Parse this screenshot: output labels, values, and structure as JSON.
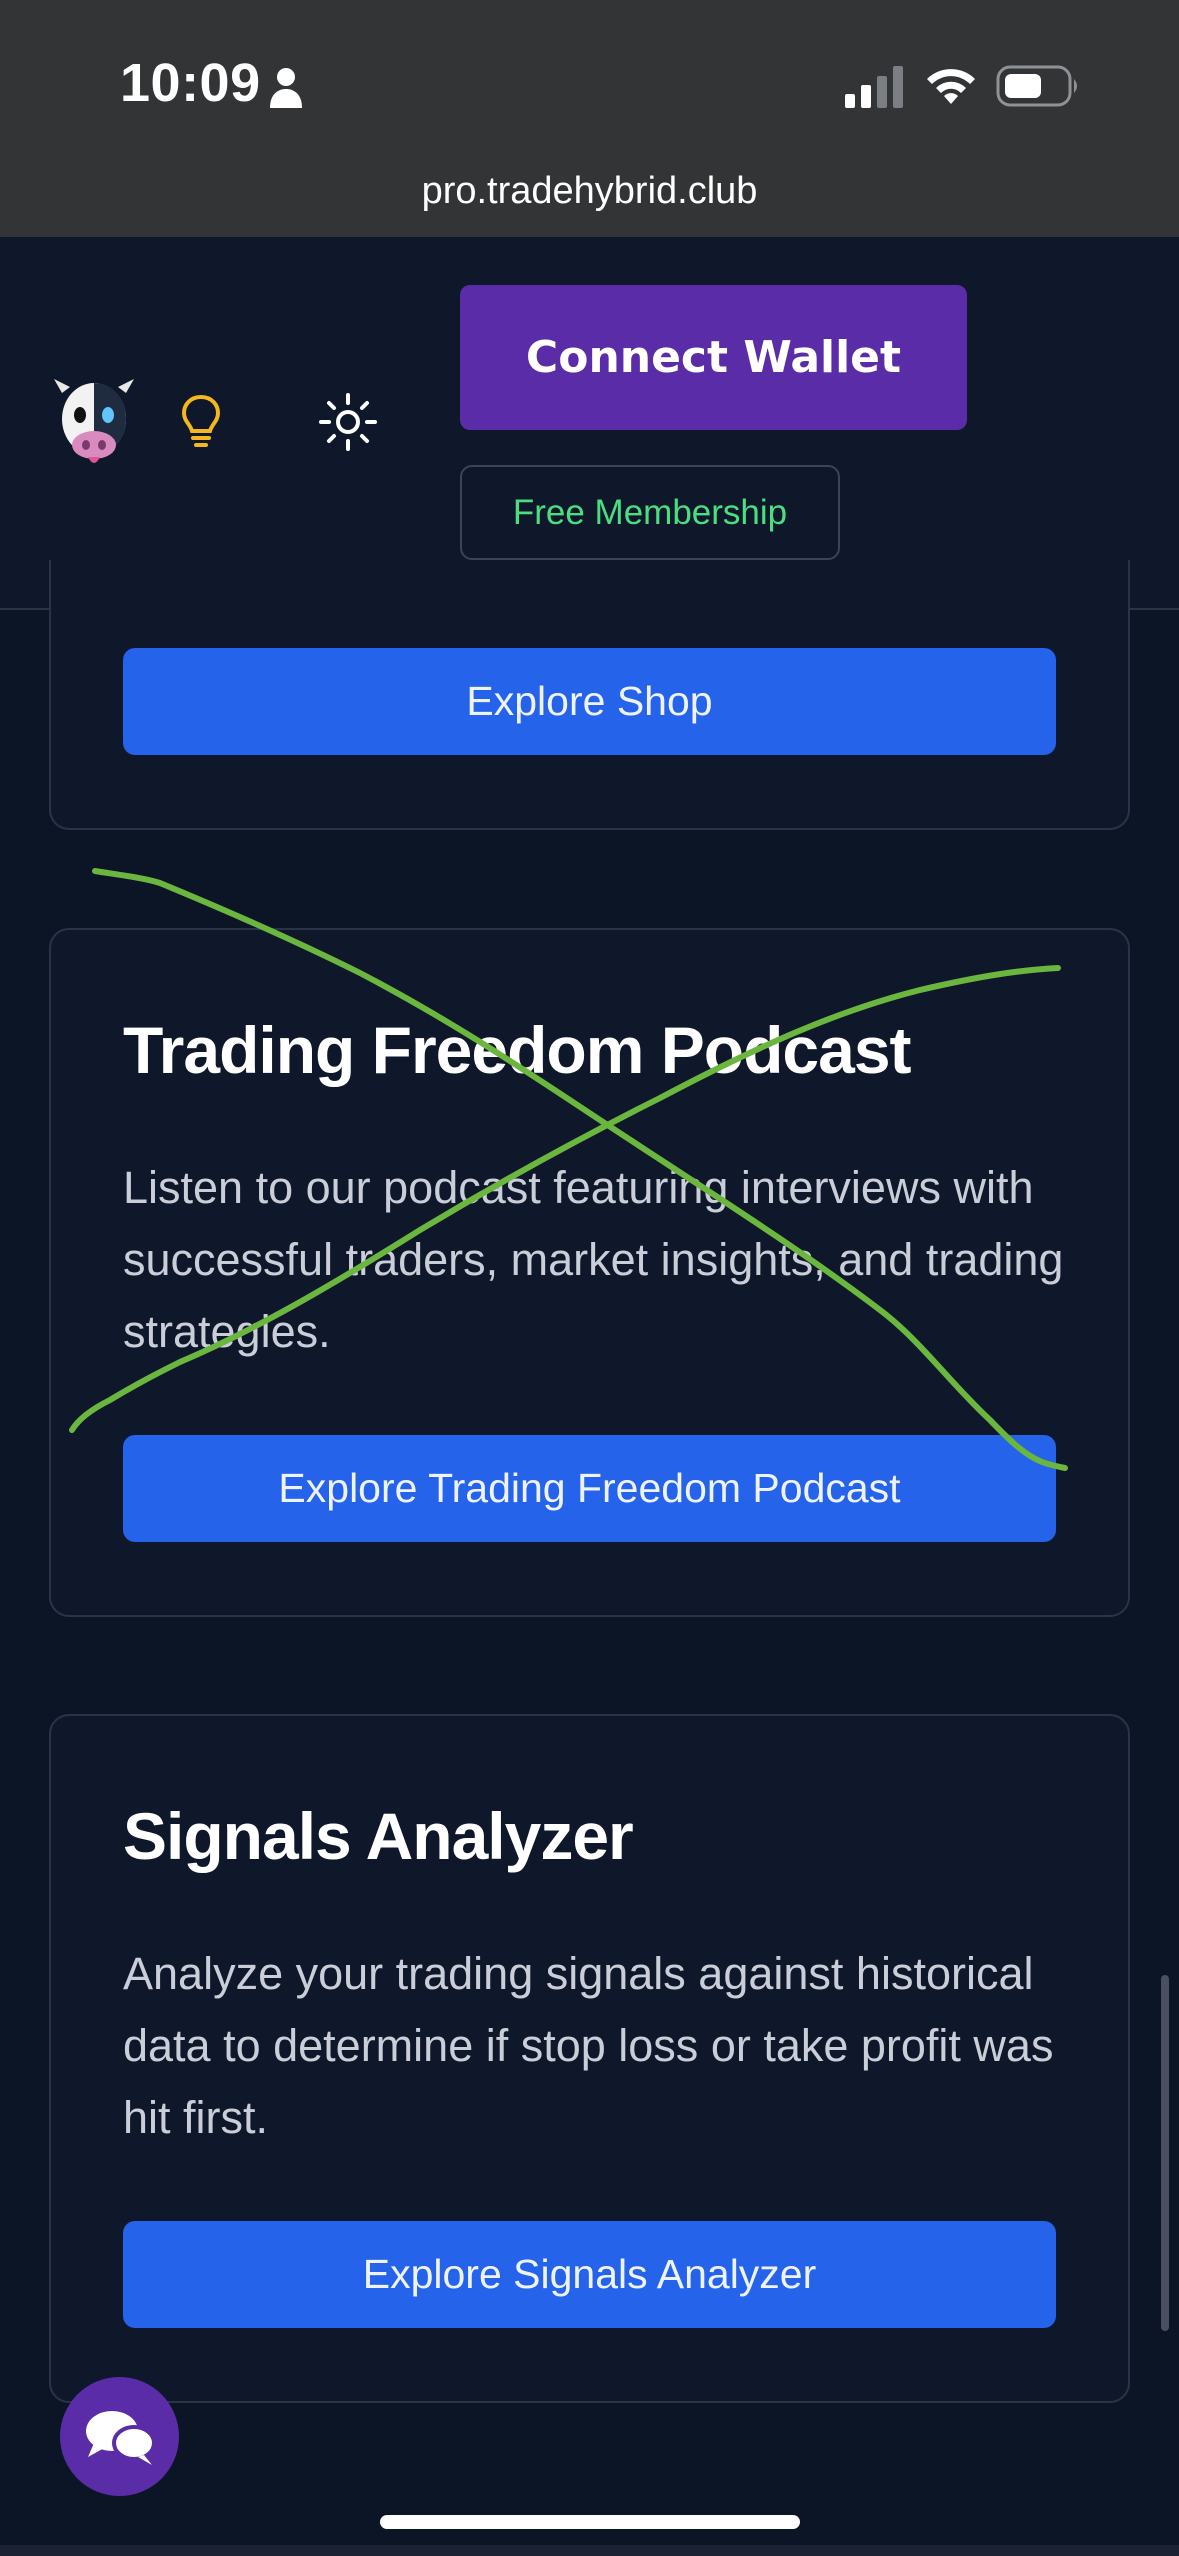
{
  "status_bar": {
    "time": "10:09"
  },
  "browser": {
    "url": "pro.tradehybrid.club"
  },
  "header": {
    "connect_wallet_label": "Connect Wallet",
    "free_membership_label": "Free Membership"
  },
  "cards": [
    {
      "button_label": "Explore Shop"
    },
    {
      "title": "Trading Freedom Podcast",
      "description": "Listen to our podcast featuring interviews with successful traders, market insights, and trading strategies.",
      "button_label": "Explore Trading Freedom Podcast"
    },
    {
      "title": "Signals Analyzer",
      "description": "Analyze your trading signals against historical data to determine if stop loss or take profit was hit first.",
      "button_label": "Explore Signals Analyzer"
    }
  ],
  "colors": {
    "page_background": "#0c1526",
    "header_background": "#0f172a",
    "connect_wallet": "#5b2ca8",
    "membership_text": "#4ade80",
    "primary_button": "#2563eb",
    "strike_mark": "#6ab63e"
  },
  "icons": [
    "person-icon",
    "signal-strength-icon",
    "wifi-icon",
    "battery-icon",
    "cow-logo",
    "lightbulb-icon",
    "sun-icon",
    "chat-icon"
  ]
}
